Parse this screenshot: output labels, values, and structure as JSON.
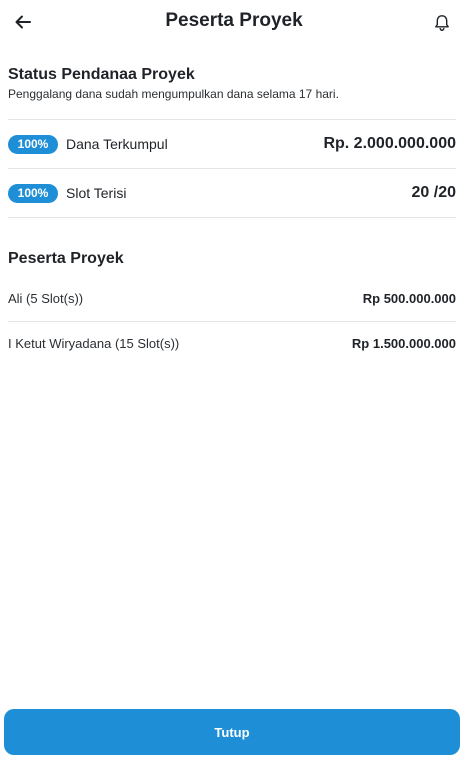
{
  "header": {
    "title": "Peserta Proyek",
    "back_icon": "arrow-left-icon",
    "notification_icon": "bell-icon"
  },
  "status": {
    "heading": "Status Pendanaa Proyek",
    "subtitle": "Penggalang dana sudah mengumpulkan dana selama 17 hari.",
    "stats": [
      {
        "badge": "100%",
        "label": "Dana Terkumpul",
        "value": "Rp. 2.000.000.000",
        "progress_percent": 100
      },
      {
        "badge": "100%",
        "label": "Slot Terisi",
        "value": "20 /20",
        "progress_percent": 100
      }
    ]
  },
  "participants": {
    "heading": "Peserta Proyek",
    "items": [
      {
        "name": "Ali (5 Slot(s))",
        "amount": "Rp 500.000.000"
      },
      {
        "name": "I Ketut Wiryadana (15 Slot(s))",
        "amount": "Rp 1.500.000.000"
      }
    ]
  },
  "footer": {
    "close_label": "Tutup"
  },
  "colors": {
    "accent": "#1e8fd6",
    "divider": "#e3e5e8",
    "text": "#1f2328"
  }
}
